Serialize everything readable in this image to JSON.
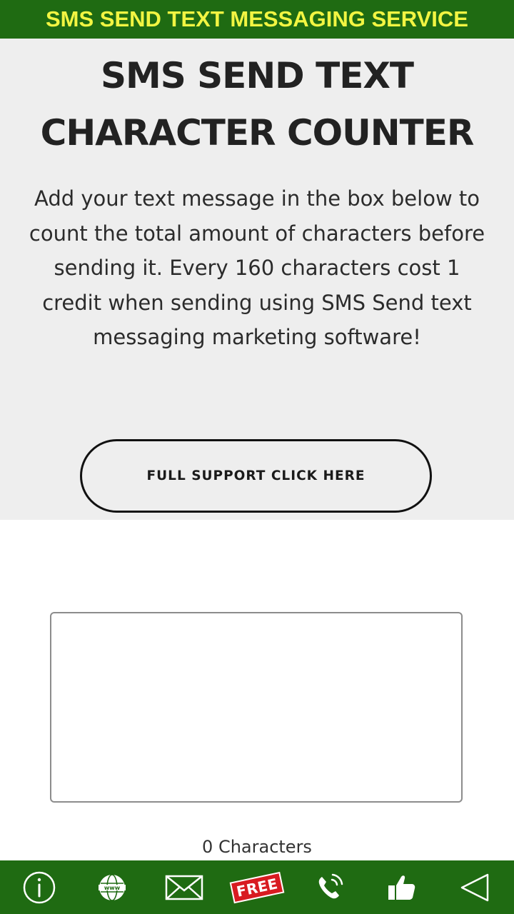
{
  "banner": {
    "title": "SMS SEND TEXT MESSAGING SERVICE"
  },
  "hero": {
    "title": "SMS SEND TEXT CHARACTER COUNTER",
    "description": "Add your text message in the box below to count the total amount of characters before sending it. Every 160 characters cost 1 credit when sending using SMS Send text messaging marketing software!",
    "support_button_label": "FULL SUPPORT CLICK HERE"
  },
  "counter": {
    "message_value": "",
    "count_label": "0 Characters"
  },
  "bottom_nav": {
    "items": [
      {
        "name": "info",
        "icon": "info-icon"
      },
      {
        "name": "website",
        "icon": "globe-www-icon"
      },
      {
        "name": "email",
        "icon": "envelope-icon"
      },
      {
        "name": "free",
        "icon": "free-badge-icon",
        "label": "FREE"
      },
      {
        "name": "call",
        "icon": "phone-icon"
      },
      {
        "name": "like",
        "icon": "thumbs-up-icon"
      },
      {
        "name": "back",
        "icon": "back-triangle-icon"
      }
    ]
  },
  "colors": {
    "banner_bg": "#1f6b12",
    "banner_text": "#f2f542",
    "hero_bg": "#eeeeee",
    "free_badge": "#d81b21"
  }
}
